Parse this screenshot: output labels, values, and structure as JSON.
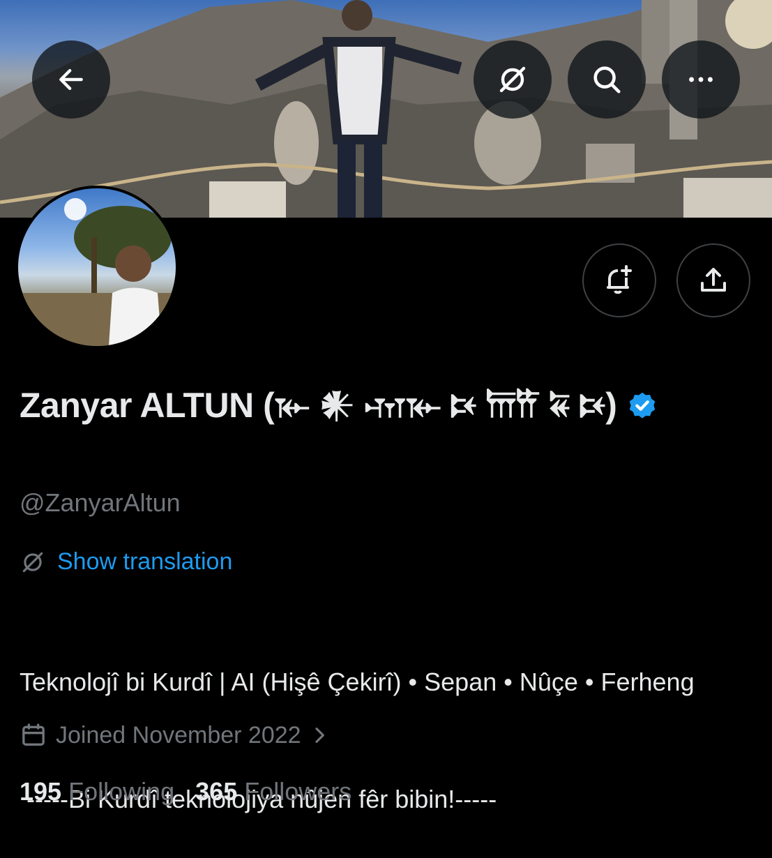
{
  "header": {
    "back_icon": "arrow-left-icon",
    "translate_icon": "translate-off-icon",
    "search_icon": "search-icon",
    "more_icon": "more-horizontal-icon"
  },
  "actions": {
    "notify_icon": "bell-plus-icon",
    "share_icon": "share-icon"
  },
  "profile": {
    "name": "Zanyar ALTUN (𐎹 𒀭 𐎶𐎹 𐎴 𐎠𐎡 𐏁 𐎴)",
    "verified_icon": "verified-badge-icon",
    "handle": "@ZanyarAltun",
    "translate_label": "Show translation",
    "bio_line1": "Teknolojî bi Kurdî | AI (Hişê Çekirî) • Sepan • Nûçe • Ferheng",
    "bio_line2": " -----Bi Kurdî teknolojiya nûjen fêr bibin!-----",
    "joined": "Joined November 2022",
    "following_count": "195",
    "following_label": "Following",
    "followers_count": "365",
    "followers_label": "Followers"
  },
  "colors": {
    "background": "#000000",
    "text_primary": "#e7e9ea",
    "text_secondary": "#71767b",
    "accent": "#1d9bf0"
  }
}
